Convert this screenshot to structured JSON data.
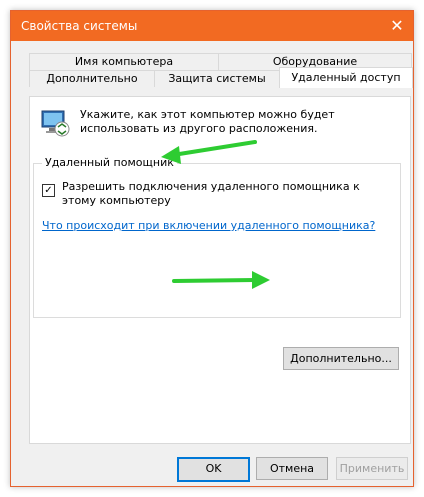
{
  "window": {
    "title": "Свойства системы",
    "close_glyph": "✕"
  },
  "tabs_row1": [
    {
      "label": "Имя компьютера"
    },
    {
      "label": "Оборудование"
    }
  ],
  "tabs_row2": [
    {
      "label": "Дополнительно"
    },
    {
      "label": "Защита системы"
    },
    {
      "label": "Удаленный доступ",
      "active": true
    }
  ],
  "remote": {
    "intro": "Укажите, как этот компьютер можно будет использовать из другого расположения.",
    "group_title": "Удаленный помощник",
    "allow_checkbox": {
      "label": "Разрешить подключения удаленного помощника к этому компьютеру",
      "checked": true,
      "glyph": "✓"
    },
    "help_link": "Что происходит при включении удаленного помощника?",
    "advanced_button": "Дополнительно..."
  },
  "footer": {
    "ok": "OK",
    "cancel": "Отмена",
    "apply": "Применить"
  },
  "colors": {
    "titlebar": "#f26a22",
    "accent": "#0078d7",
    "link": "#0066cc",
    "arrow": "#2ecc32"
  },
  "icons": [
    "computer-icon",
    "close-icon",
    "green-arrow"
  ]
}
